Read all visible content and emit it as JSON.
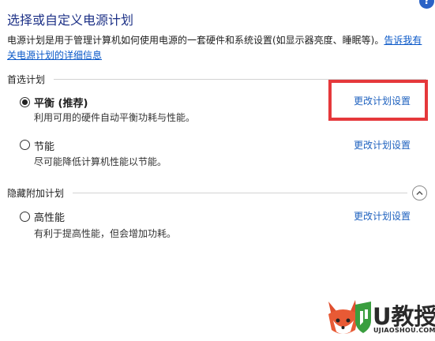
{
  "header": {
    "title": "选择或自定义电源计划",
    "help_glyph": "?"
  },
  "description": {
    "text": "电源计划是用于管理计算机如何使用电源的一套硬件和系统设置(如显示器亮度、睡眠等)。",
    "link": "告诉我有关电源计划的详细信息"
  },
  "sections": {
    "preferred_label": "首选计划",
    "hidden_label": "隐藏附加计划"
  },
  "plans": [
    {
      "name": "平衡 (推荐)",
      "desc": "利用可用的硬件自动平衡功耗与性能。",
      "link": "更改计划设置",
      "selected": true
    },
    {
      "name": "节能",
      "desc": "尽可能降低计算机性能以节能。",
      "link": "更改计划设置",
      "selected": false
    },
    {
      "name": "高性能",
      "desc": "有利于提高性能，但会增加功耗。",
      "link": "更改计划设置",
      "selected": false
    }
  ],
  "watermark": {
    "brand": "U教授",
    "url": "UJIAOSHOU.COM"
  },
  "colors": {
    "title": "#1e3287",
    "link": "#1f62bf",
    "highlight": "#e5383b",
    "help": "#2a62c6"
  },
  "icons": [
    "help-icon",
    "radio-selected-icon",
    "radio-unselected-icon",
    "collapse-up-icon",
    "fox-logo-icon",
    "shield-logo-icon"
  ]
}
